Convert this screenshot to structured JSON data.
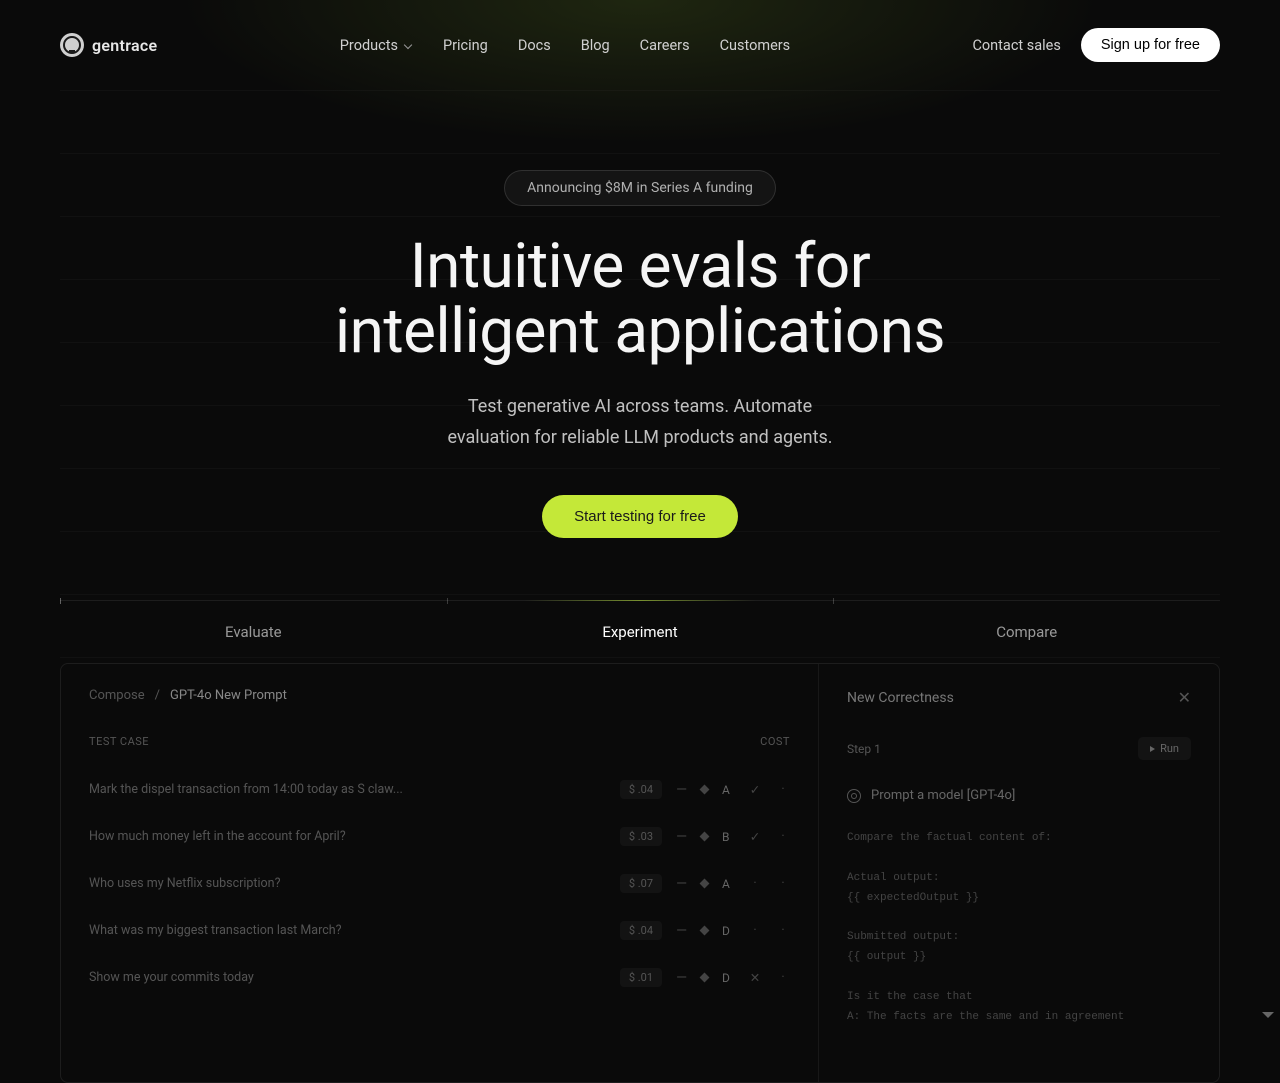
{
  "brand": "gentrace",
  "nav": {
    "items": [
      {
        "label": "Products",
        "hasDropdown": true
      },
      {
        "label": "Pricing",
        "hasDropdown": false
      },
      {
        "label": "Docs",
        "hasDropdown": false
      },
      {
        "label": "Blog",
        "hasDropdown": false
      },
      {
        "label": "Careers",
        "hasDropdown": false
      },
      {
        "label": "Customers",
        "hasDropdown": false
      }
    ]
  },
  "header_actions": {
    "contact": "Contact sales",
    "signup": "Sign up for free"
  },
  "hero": {
    "announcement": "Announcing $8M in Series A funding",
    "title_line1": "Intuitive evals for",
    "title_line2": "intelligent applications",
    "subtitle_line1": "Test generative AI across teams. Automate",
    "subtitle_line2": "evaluation for reliable LLM products and agents.",
    "cta": "Start testing for free"
  },
  "tabs": [
    {
      "label": "Evaluate",
      "active": false
    },
    {
      "label": "Experiment",
      "active": true
    },
    {
      "label": "Compare",
      "active": false
    }
  ],
  "preview": {
    "breadcrumb": {
      "parent": "Compose",
      "current": "GPT-4o New Prompt"
    },
    "test_header": {
      "left": "Test Case",
      "right": "Cost"
    },
    "test_rows": [
      {
        "text": "Mark the dispel transaction from 14:00 today as S claw...",
        "cost": "$ .04",
        "grade": "A",
        "status": "check"
      },
      {
        "text": "How much money left in the account for April?",
        "cost": "$ .03",
        "grade": "B",
        "status": "check"
      },
      {
        "text": "Who uses my Netflix subscription?",
        "cost": "$ .07",
        "grade": "A",
        "status": "none"
      },
      {
        "text": "What was my biggest transaction last March?",
        "cost": "$ .04",
        "grade": "D",
        "status": "none"
      },
      {
        "text": "Show me your commits today",
        "cost": "$ .01",
        "grade": "D",
        "status": "x"
      }
    ],
    "right_panel": {
      "title": "New Correctness",
      "step": "Step 1",
      "run": "Run",
      "prompt_label": "Prompt a model [GPT-4o]",
      "code": "Compare the factual content of:\n\nActual output:\n{{ expectedOutput }}\n\nSubmitted output:\n{{ output }}\n\nIs it the case that\nA: The facts are the same and in agreement"
    }
  }
}
